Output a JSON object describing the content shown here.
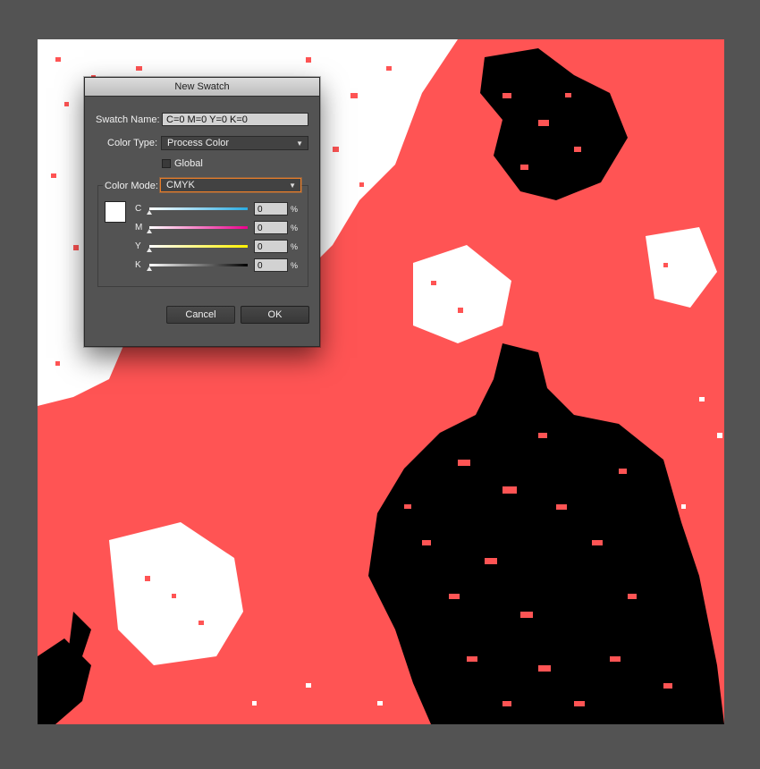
{
  "dialog": {
    "title": "New Swatch",
    "swatch_name_label": "Swatch Name:",
    "swatch_name_value": "C=0 M=0 Y=0 K=0",
    "color_type_label": "Color Type:",
    "color_type_value": "Process Color",
    "global_label": "Global",
    "global_checked": false,
    "color_mode_label": "Color Mode:",
    "color_mode_value": "CMYK",
    "preview_color": "#ffffff",
    "sliders": [
      {
        "letter": "C",
        "value": "0",
        "unit": "%",
        "track_color": "#29abe2"
      },
      {
        "letter": "M",
        "value": "0",
        "unit": "%",
        "track_color": "#ec008c"
      },
      {
        "letter": "Y",
        "value": "0",
        "unit": "%",
        "track_color": "#fff200"
      },
      {
        "letter": "K",
        "value": "0",
        "unit": "%",
        "track_color": "#000000"
      }
    ],
    "cancel_label": "Cancel",
    "ok_label": "OK"
  },
  "colors": {
    "workspace": "#535353",
    "artwork_red": "#ff5454",
    "artwork_black": "#000000",
    "artwork_white": "#ffffff",
    "focus_ring": "#e87d2a"
  }
}
